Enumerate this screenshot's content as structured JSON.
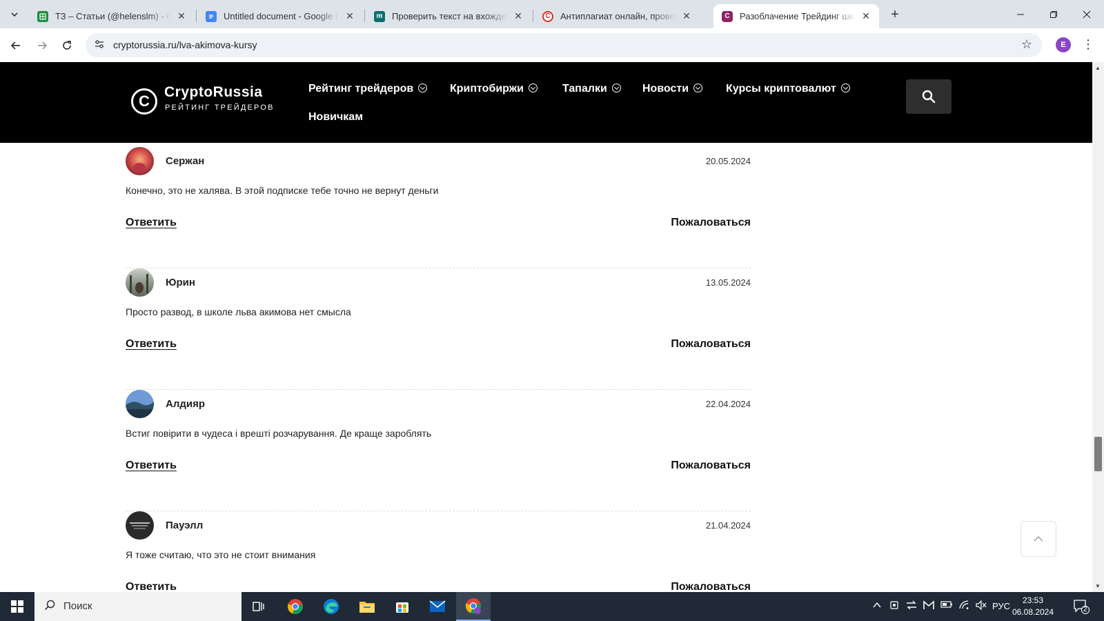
{
  "browser": {
    "tabs": [
      {
        "title": "ТЗ – Статьи (@helenslm) - Google",
        "icon": "sheets-icon",
        "color": "#1e8e3e"
      },
      {
        "title": "Untitled document - Google Docs",
        "icon": "docs-icon",
        "color": "#4285f4"
      },
      {
        "title": "Проверить текст на вхождение",
        "icon": "mtext-icon",
        "color": "#0d6e6e"
      },
      {
        "title": "Антиплагиат онлайн, проверка",
        "icon": "antiplagiat-icon",
        "color": "#d93025"
      },
      {
        "title": "Разоблачение Трейдинг школа",
        "icon": "cryptorussia-icon",
        "color": "#8e2466",
        "active": true
      }
    ],
    "url": "cryptorussia.ru/lva-akimova-kursy",
    "profile_initial": "E"
  },
  "site": {
    "logo_name": "CryptoRussia",
    "logo_sub": "РЕЙТИНГ ТРЕЙДЕРОВ",
    "nav": [
      {
        "label": "Рейтинг трейдеров",
        "has_dropdown": true
      },
      {
        "label": "Криптобиржи",
        "has_dropdown": true
      },
      {
        "label": "Тапалки",
        "has_dropdown": true
      },
      {
        "label": "Новости",
        "has_dropdown": true
      },
      {
        "label": "Курсы криптовалют",
        "has_dropdown": true
      },
      {
        "label": "Новичкам",
        "has_dropdown": false
      }
    ]
  },
  "comments": [
    {
      "author": "Сержан",
      "date": "20.05.2024",
      "text": "Конечно, это не халява. В этой подписке тебе точно не вернут деньги",
      "reply": "Ответить",
      "report": "Пожаловаться"
    },
    {
      "author": "Юрин",
      "date": "13.05.2024",
      "text": "Просто развод, в школе льва акимова нет смысла",
      "reply": "Ответить",
      "report": "Пожаловаться"
    },
    {
      "author": "Алдияр",
      "date": "22.04.2024",
      "text": "Встиг повірити в чудеса і врешті розчарування. Де краще зароблять",
      "reply": "Ответить",
      "report": "Пожаловаться"
    },
    {
      "author": "Пауэлл",
      "date": "21.04.2024",
      "text": "Я тоже считаю, что это не стоит внимания",
      "reply": "Ответить",
      "report": "Пожаловаться"
    }
  ],
  "taskbar": {
    "search_label": "Поиск",
    "language": "РУС",
    "time": "23:53",
    "date": "06.08.2024",
    "notification_count": "2"
  }
}
